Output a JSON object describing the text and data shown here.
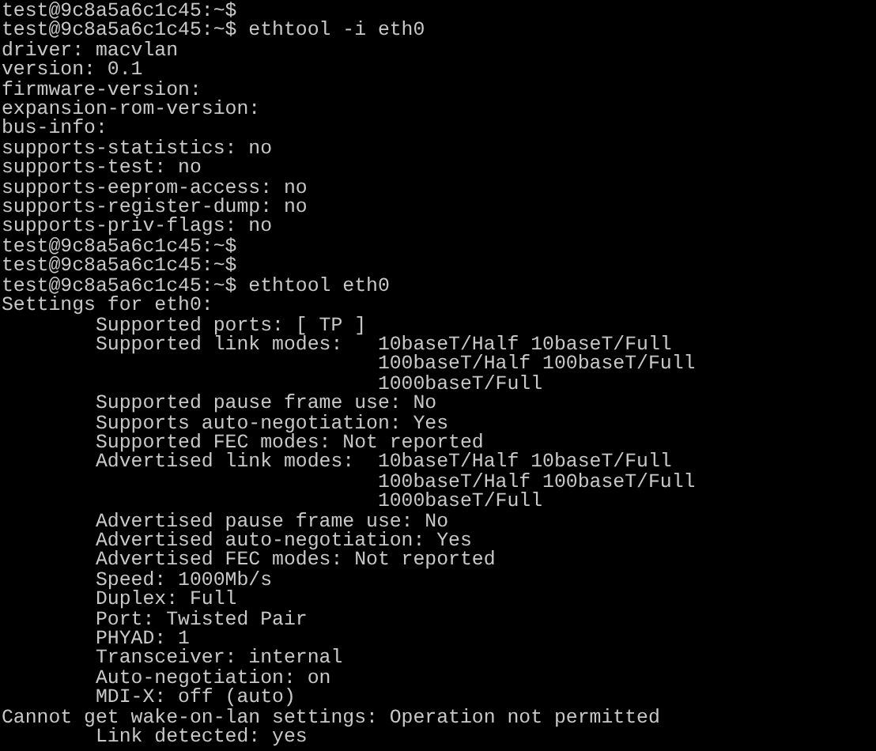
{
  "terminal": {
    "lines": [
      "test@9c8a5a6c1c45:~$",
      "test@9c8a5a6c1c45:~$ ethtool -i eth0",
      "driver: macvlan",
      "version: 0.1",
      "firmware-version:",
      "expansion-rom-version:",
      "bus-info:",
      "supports-statistics: no",
      "supports-test: no",
      "supports-eeprom-access: no",
      "supports-register-dump: no",
      "supports-priv-flags: no",
      "test@9c8a5a6c1c45:~$",
      "test@9c8a5a6c1c45:~$",
      "test@9c8a5a6c1c45:~$ ethtool eth0",
      "Settings for eth0:",
      "        Supported ports: [ TP ]",
      "        Supported link modes:   10baseT/Half 10baseT/Full",
      "                                100baseT/Half 100baseT/Full",
      "                                1000baseT/Full",
      "        Supported pause frame use: No",
      "        Supports auto-negotiation: Yes",
      "        Supported FEC modes: Not reported",
      "        Advertised link modes:  10baseT/Half 10baseT/Full",
      "                                100baseT/Half 100baseT/Full",
      "                                1000baseT/Full",
      "        Advertised pause frame use: No",
      "        Advertised auto-negotiation: Yes",
      "        Advertised FEC modes: Not reported",
      "        Speed: 1000Mb/s",
      "        Duplex: Full",
      "        Port: Twisted Pair",
      "        PHYAD: 1",
      "        Transceiver: internal",
      "        Auto-negotiation: on",
      "        MDI-X: off (auto)",
      "Cannot get wake-on-lan settings: Operation not permitted",
      "        Link detected: yes"
    ]
  }
}
